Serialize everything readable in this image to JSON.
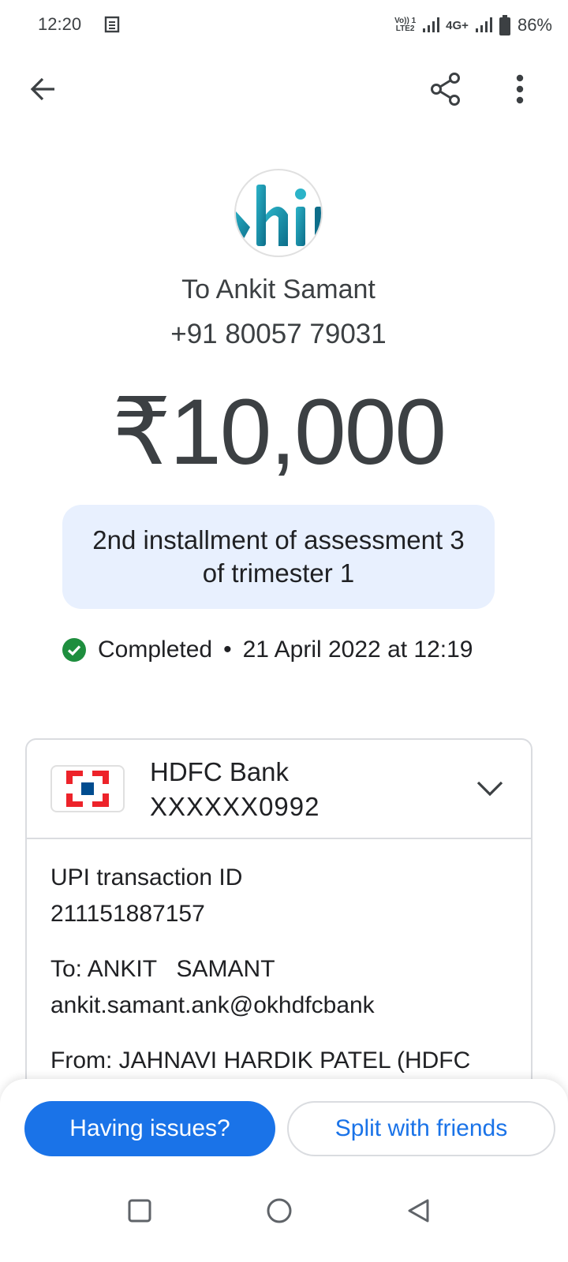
{
  "status_bar": {
    "time": "12:20",
    "volte_line1": "Vo)) 1",
    "volte_line2": "LTE2",
    "network": "4G+",
    "battery": "86%"
  },
  "icons": {
    "back": "back-arrow-icon",
    "share": "share-icon",
    "more": "more-vert-icon",
    "check": "check-circle-icon",
    "chevron": "chevron-down-icon",
    "bank_logo": "hdfc-logo-icon",
    "nav_recent": "square-icon",
    "nav_home": "circle-icon",
    "nav_back": "triangle-icon"
  },
  "recipient": {
    "name": "To Ankit Samant",
    "phone": "+91 80057 79031"
  },
  "amount": "₹10,000",
  "note": "2nd installment of assessment 3 of trimester 1",
  "payment_status": {
    "state": "Completed",
    "separator": "•",
    "datetime": "21 April 2022 at 12:19"
  },
  "bank": {
    "name": "HDFC Bank",
    "account": "XXXXXX0992"
  },
  "details": {
    "upi_label": "UPI transaction ID",
    "upi_id": "211151887157",
    "to_label": "To: ANKIT   SAMANT",
    "to_vpa": "ankit.samant.ank@okhdfcbank",
    "from_label": "From: JAHNAVI HARDIK PATEL (HDFC"
  },
  "actions": {
    "issues": "Having issues?",
    "split": "Split with friends"
  },
  "colors": {
    "accent": "#1a73e8",
    "note_bg": "#e8f0fe",
    "success": "#1e8e3e",
    "hdfc_red": "#ed232a",
    "hdfc_blue": "#004c8f"
  }
}
